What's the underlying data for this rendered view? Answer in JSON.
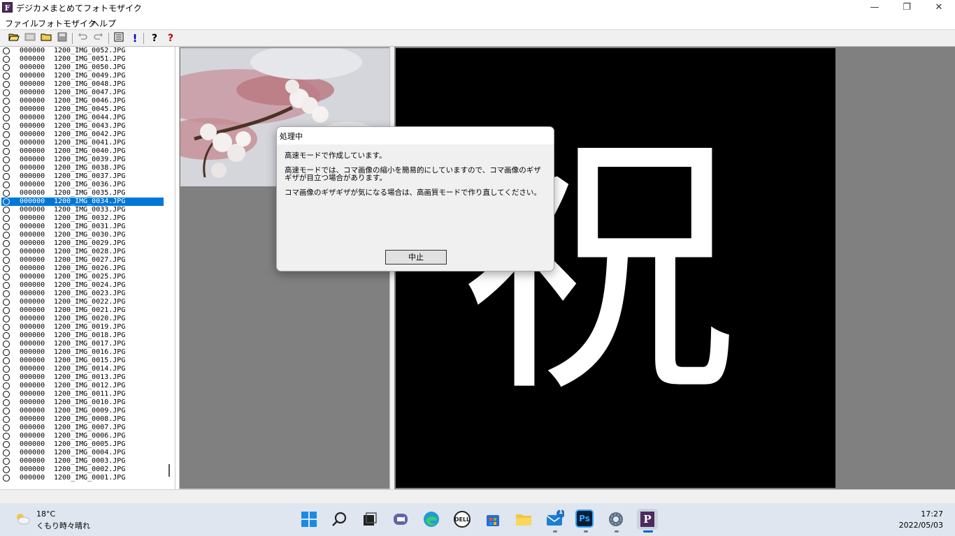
{
  "window": {
    "title": "デジカメまとめてフォトモザイク",
    "app_icon_letter": "F",
    "minimize": "—",
    "maximize": "❐",
    "close": "✕"
  },
  "menu": [
    "ファイル",
    "フォトモザイク",
    "ヘルプ"
  ],
  "toolbar": {
    "icons": [
      "open-folder-icon",
      "image-icon",
      "folder-icon",
      "save-icon",
      "undo-icon",
      "redo-icon",
      "list-icon",
      "exclamation-icon",
      "help-icon",
      "context-help-icon"
    ]
  },
  "file_list": {
    "selected_index": 18,
    "rows": [
      {
        "num": "000000",
        "name": "1200_IMG_0052.JPG"
      },
      {
        "num": "000000",
        "name": "1200_IMG_0051.JPG"
      },
      {
        "num": "000000",
        "name": "1200_IMG_0050.JPG"
      },
      {
        "num": "000000",
        "name": "1200_IMG_0049.JPG"
      },
      {
        "num": "000000",
        "name": "1200_IMG_0048.JPG"
      },
      {
        "num": "000000",
        "name": "1200_IMG_0047.JPG"
      },
      {
        "num": "000000",
        "name": "1200_IMG_0046.JPG"
      },
      {
        "num": "000000",
        "name": "1200_IMG_0045.JPG"
      },
      {
        "num": "000000",
        "name": "1200_IMG_0044.JPG"
      },
      {
        "num": "000000",
        "name": "1200_IMG_0043.JPG"
      },
      {
        "num": "000000",
        "name": "1200_IMG_0042.JPG"
      },
      {
        "num": "000000",
        "name": "1200_IMG_0041.JPG"
      },
      {
        "num": "000000",
        "name": "1200_IMG_0040.JPG"
      },
      {
        "num": "000000",
        "name": "1200_IMG_0039.JPG"
      },
      {
        "num": "000000",
        "name": "1200_IMG_0038.JPG"
      },
      {
        "num": "000000",
        "name": "1200_IMG_0037.JPG"
      },
      {
        "num": "000000",
        "name": "1200_IMG_0036.JPG"
      },
      {
        "num": "000000",
        "name": "1200_IMG_0035.JPG"
      },
      {
        "num": "000000",
        "name": "1200_IMG_0034.JPG"
      },
      {
        "num": "000000",
        "name": "1200_IMG_0033.JPG"
      },
      {
        "num": "000000",
        "name": "1200_IMG_0032.JPG"
      },
      {
        "num": "000000",
        "name": "1200_IMG_0031.JPG"
      },
      {
        "num": "000000",
        "name": "1200_IMG_0030.JPG"
      },
      {
        "num": "000000",
        "name": "1200_IMG_0029.JPG"
      },
      {
        "num": "000000",
        "name": "1200_IMG_0028.JPG"
      },
      {
        "num": "000000",
        "name": "1200_IMG_0027.JPG"
      },
      {
        "num": "000000",
        "name": "1200_IMG_0026.JPG"
      },
      {
        "num": "000000",
        "name": "1200_IMG_0025.JPG"
      },
      {
        "num": "000000",
        "name": "1200_IMG_0024.JPG"
      },
      {
        "num": "000000",
        "name": "1200_IMG_0023.JPG"
      },
      {
        "num": "000000",
        "name": "1200_IMG_0022.JPG"
      },
      {
        "num": "000000",
        "name": "1200_IMG_0021.JPG"
      },
      {
        "num": "000000",
        "name": "1200_IMG_0020.JPG"
      },
      {
        "num": "000000",
        "name": "1200_IMG_0019.JPG"
      },
      {
        "num": "000000",
        "name": "1200_IMG_0018.JPG"
      },
      {
        "num": "000000",
        "name": "1200_IMG_0017.JPG"
      },
      {
        "num": "000000",
        "name": "1200_IMG_0016.JPG"
      },
      {
        "num": "000000",
        "name": "1200_IMG_0015.JPG"
      },
      {
        "num": "000000",
        "name": "1200_IMG_0014.JPG"
      },
      {
        "num": "000000",
        "name": "1200_IMG_0013.JPG"
      },
      {
        "num": "000000",
        "name": "1200_IMG_0012.JPG"
      },
      {
        "num": "000000",
        "name": "1200_IMG_0011.JPG"
      },
      {
        "num": "000000",
        "name": "1200_IMG_0010.JPG"
      },
      {
        "num": "000000",
        "name": "1200_IMG_0009.JPG"
      },
      {
        "num": "000000",
        "name": "1200_IMG_0008.JPG"
      },
      {
        "num": "000000",
        "name": "1200_IMG_0007.JPG"
      },
      {
        "num": "000000",
        "name": "1200_IMG_0006.JPG"
      },
      {
        "num": "000000",
        "name": "1200_IMG_0005.JPG"
      },
      {
        "num": "000000",
        "name": "1200_IMG_0004.JPG"
      },
      {
        "num": "000000",
        "name": "1200_IMG_0003.JPG"
      },
      {
        "num": "000000",
        "name": "1200_IMG_0002.JPG"
      },
      {
        "num": "000000",
        "name": "1200_IMG_0001.JPG"
      }
    ]
  },
  "preview": {
    "target_character": "祝",
    "colors": {
      "canvas": "#000000",
      "glyph": "#ffffff",
      "panel": "#808080",
      "selection": "#0078d7"
    }
  },
  "dialog": {
    "title": "処理中",
    "line1": "高速モードで作成しています。",
    "line2": "高速モードでは、コマ画像の縮小を簡易的にしていますので、コマ画像のギザギザが目立つ場合があります。",
    "line3": "コマ画像のギザギザが気になる場合は、高画質モードで作り直してください。",
    "button": "中止"
  },
  "taskbar": {
    "temperature": "18°C",
    "weather": "くもり時々晴れ",
    "time": "17:27",
    "date": "2022/05/03",
    "mail_badge": "1",
    "photoshop_label": "Ps",
    "app_label": "P",
    "icons": [
      "start-icon",
      "search-icon",
      "task-view-icon",
      "chat-icon",
      "edge-icon",
      "dell-icon",
      "store-icon",
      "explorer-icon",
      "mail-icon",
      "photoshop-icon",
      "settings-icon",
      "photomosaic-icon"
    ]
  }
}
